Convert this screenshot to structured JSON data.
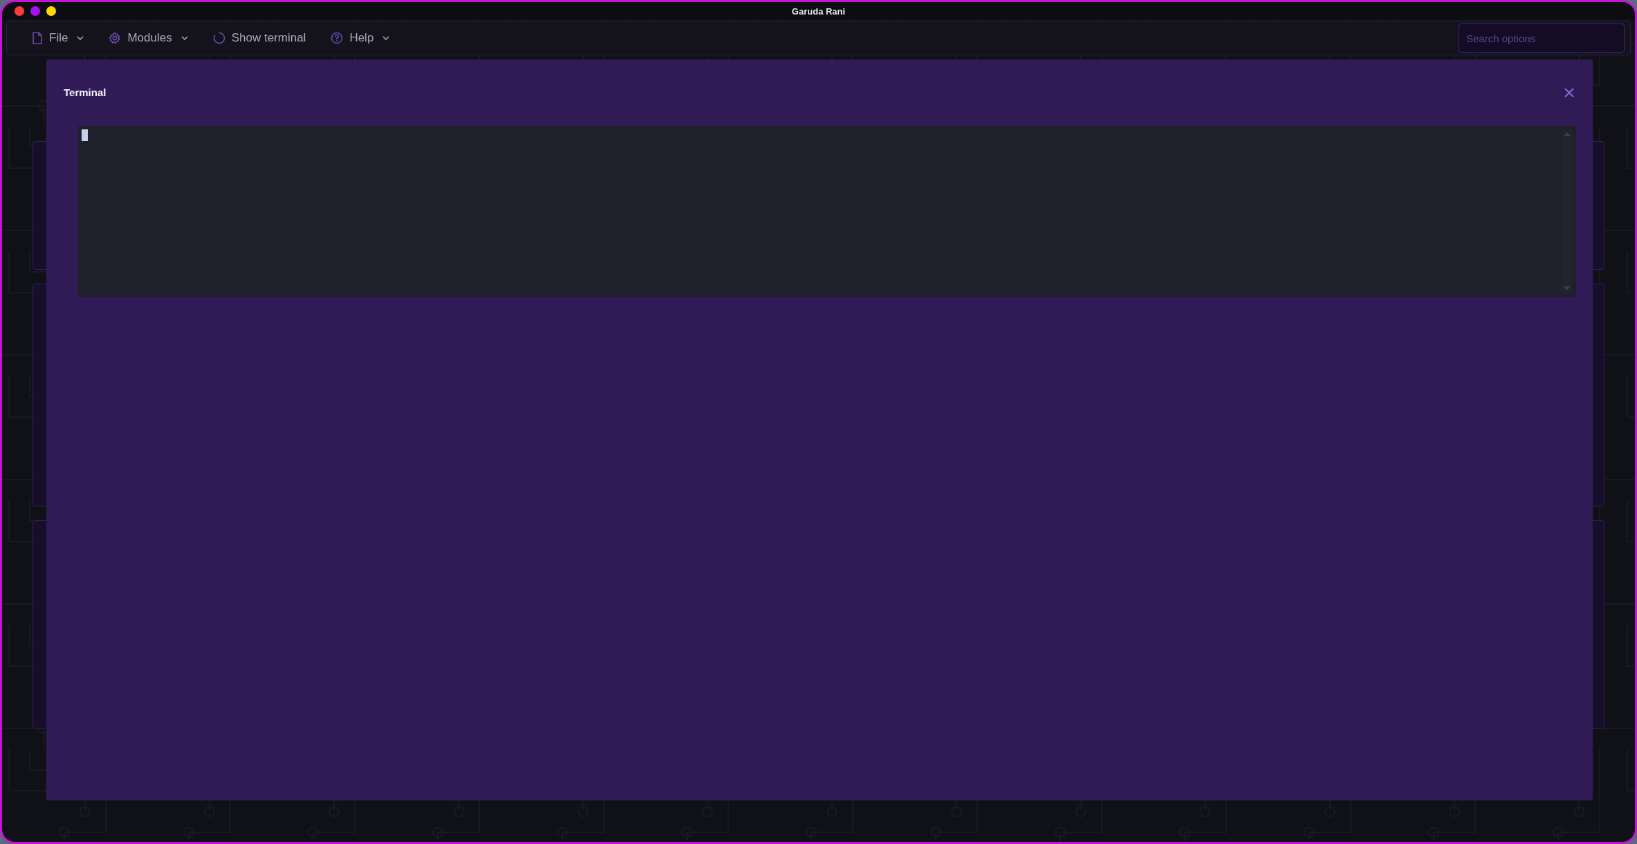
{
  "window": {
    "title": "Garuda Rani"
  },
  "menu": [
    {
      "label": "File",
      "kind": "file",
      "caret": true
    },
    {
      "label": "Modules",
      "kind": "gear",
      "caret": true
    },
    {
      "label": "Show terminal",
      "kind": "spinner",
      "caret": false
    },
    {
      "label": "Help",
      "kind": "help",
      "caret": true
    }
  ],
  "search": {
    "placeholder": "Search options"
  },
  "dialog": {
    "title": "Terminal",
    "terminal": {
      "cursor": true
    }
  }
}
